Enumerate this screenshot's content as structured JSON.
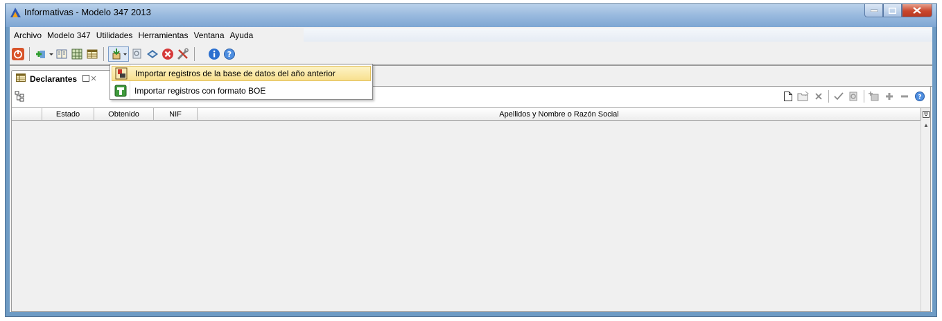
{
  "window": {
    "title": "Informativas - Modelo 347 2013",
    "controls": [
      "minimize",
      "maximize",
      "close"
    ]
  },
  "menubar": {
    "items": [
      "Archivo",
      "Modelo 347",
      "Utilidades",
      "Herramientas",
      "Ventana",
      "Ayuda"
    ]
  },
  "toolbar": {
    "icons": [
      "power-icon",
      "add-icon",
      "dropdown-arrow-icon",
      "book-icon",
      "grid-icon",
      "table-icon",
      "import-icon",
      "dropdown-arrow-icon",
      "search-icon",
      "book-open-icon",
      "cancel-icon",
      "tools-icon",
      "info-icon",
      "help-icon"
    ]
  },
  "tabs": [
    {
      "label": "Declarantes"
    }
  ],
  "panel_toolbar": {
    "icons": [
      "new-document-icon",
      "open-icon",
      "delete-icon",
      "check-icon",
      "search-icon",
      "import-icon",
      "add-row-icon",
      "remove-row-icon",
      "help-icon"
    ]
  },
  "table": {
    "columns": [
      "",
      "Estado",
      "Obtenido",
      "NIF",
      "Apellidos y Nombre o Razón Social"
    ],
    "rows": []
  },
  "dropdown_menu": {
    "items": [
      {
        "label": "Importar registros de la base de datos del año anterior",
        "selected": true,
        "icon": "database-import-icon"
      },
      {
        "label": "Importar registros con formato BOE",
        "selected": false,
        "icon": "file-import-icon"
      }
    ]
  },
  "colors": {
    "titlebar": "#9bbbdf",
    "menu_highlight": "#f8e08e",
    "window_bg": "#f0f0f0"
  }
}
